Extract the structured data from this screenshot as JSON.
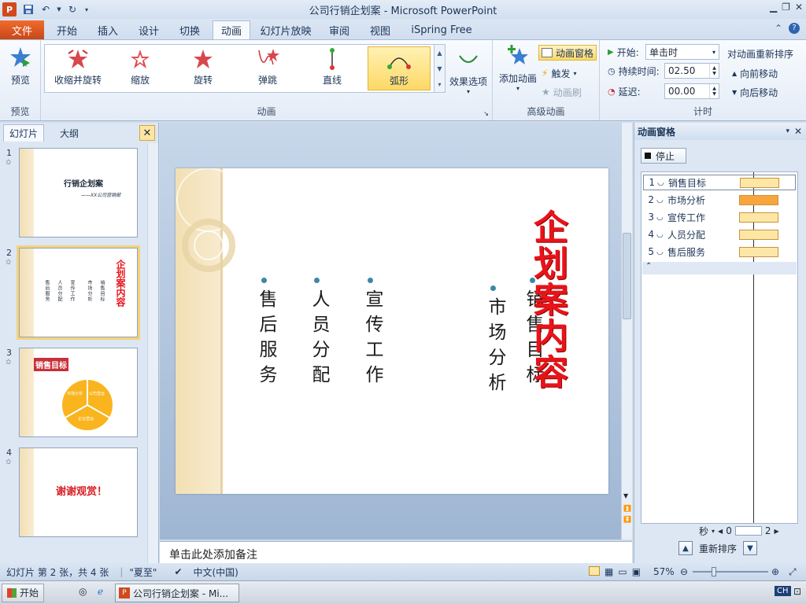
{
  "window": {
    "title": "公司行销企划案 - Microsoft PowerPoint"
  },
  "tabs": {
    "file": "文件",
    "items": [
      "开始",
      "插入",
      "设计",
      "切换",
      "动画",
      "幻灯片放映",
      "审阅",
      "视图",
      "iSpring Free"
    ],
    "active": "动画"
  },
  "ribbon": {
    "preview": {
      "button": "预览",
      "group": "预览"
    },
    "animation": {
      "group": "动画",
      "items": [
        "收缩并旋转",
        "缩放",
        "旋转",
        "弹跳",
        "直线",
        "弧形"
      ],
      "selected": "弧形",
      "effect_options": "效果选项"
    },
    "advanced": {
      "group": "高级动画",
      "add_animation": "添加动画",
      "animation_pane": "动画窗格",
      "trigger": "触发",
      "animation_painter": "动画刷"
    },
    "timing": {
      "group": "计时",
      "start_label": "开始:",
      "start_value": "单击时",
      "duration_label": "持续时间:",
      "duration_value": "02.50",
      "delay_label": "延迟:",
      "delay_value": "00.00",
      "reorder_title": "对动画重新排序",
      "move_earlier": "向前移动",
      "move_later": "向后移动"
    }
  },
  "left_pane": {
    "tabs": [
      "幻灯片",
      "大纲"
    ],
    "slides": [
      {
        "num": "1",
        "title": "行销企划案",
        "subtitle": "——XX公司营销部"
      },
      {
        "num": "2",
        "title": "企划案内容",
        "items": [
          "销售目标",
          "市场分析",
          "宣传工作",
          "人员分配",
          "售后服务"
        ]
      },
      {
        "num": "3",
        "title": "销售目标",
        "chart_labels": [
          "市场分析",
          "公司营运",
          "企业营运"
        ]
      },
      {
        "num": "4",
        "title": "谢谢观赏！"
      }
    ]
  },
  "slide": {
    "title": "企划案内容",
    "columns": [
      "售后服务",
      "人员分配",
      "宣传工作",
      "市场分析",
      "销售目标"
    ]
  },
  "notes": {
    "placeholder": "单击此处添加备注"
  },
  "animation_pane": {
    "title": "动画窗格",
    "stop": "停止",
    "items": [
      {
        "num": "1",
        "name": "销售目标"
      },
      {
        "num": "2",
        "name": "市场分析"
      },
      {
        "num": "3",
        "name": "宣传工作"
      },
      {
        "num": "4",
        "name": "人员分配"
      },
      {
        "num": "5",
        "name": "售后服务"
      }
    ],
    "time_unit": "秒",
    "time_start": "0",
    "time_end": "2",
    "reorder": "重新排序"
  },
  "status": {
    "slide_info": "幻灯片 第 2 张，共 4 张",
    "theme": "\"夏至\"",
    "language": "中文(中国)",
    "zoom": "57%"
  },
  "taskbar": {
    "start": "开始",
    "task": "公司行销企划案 - Mi...",
    "ime": "CH"
  }
}
